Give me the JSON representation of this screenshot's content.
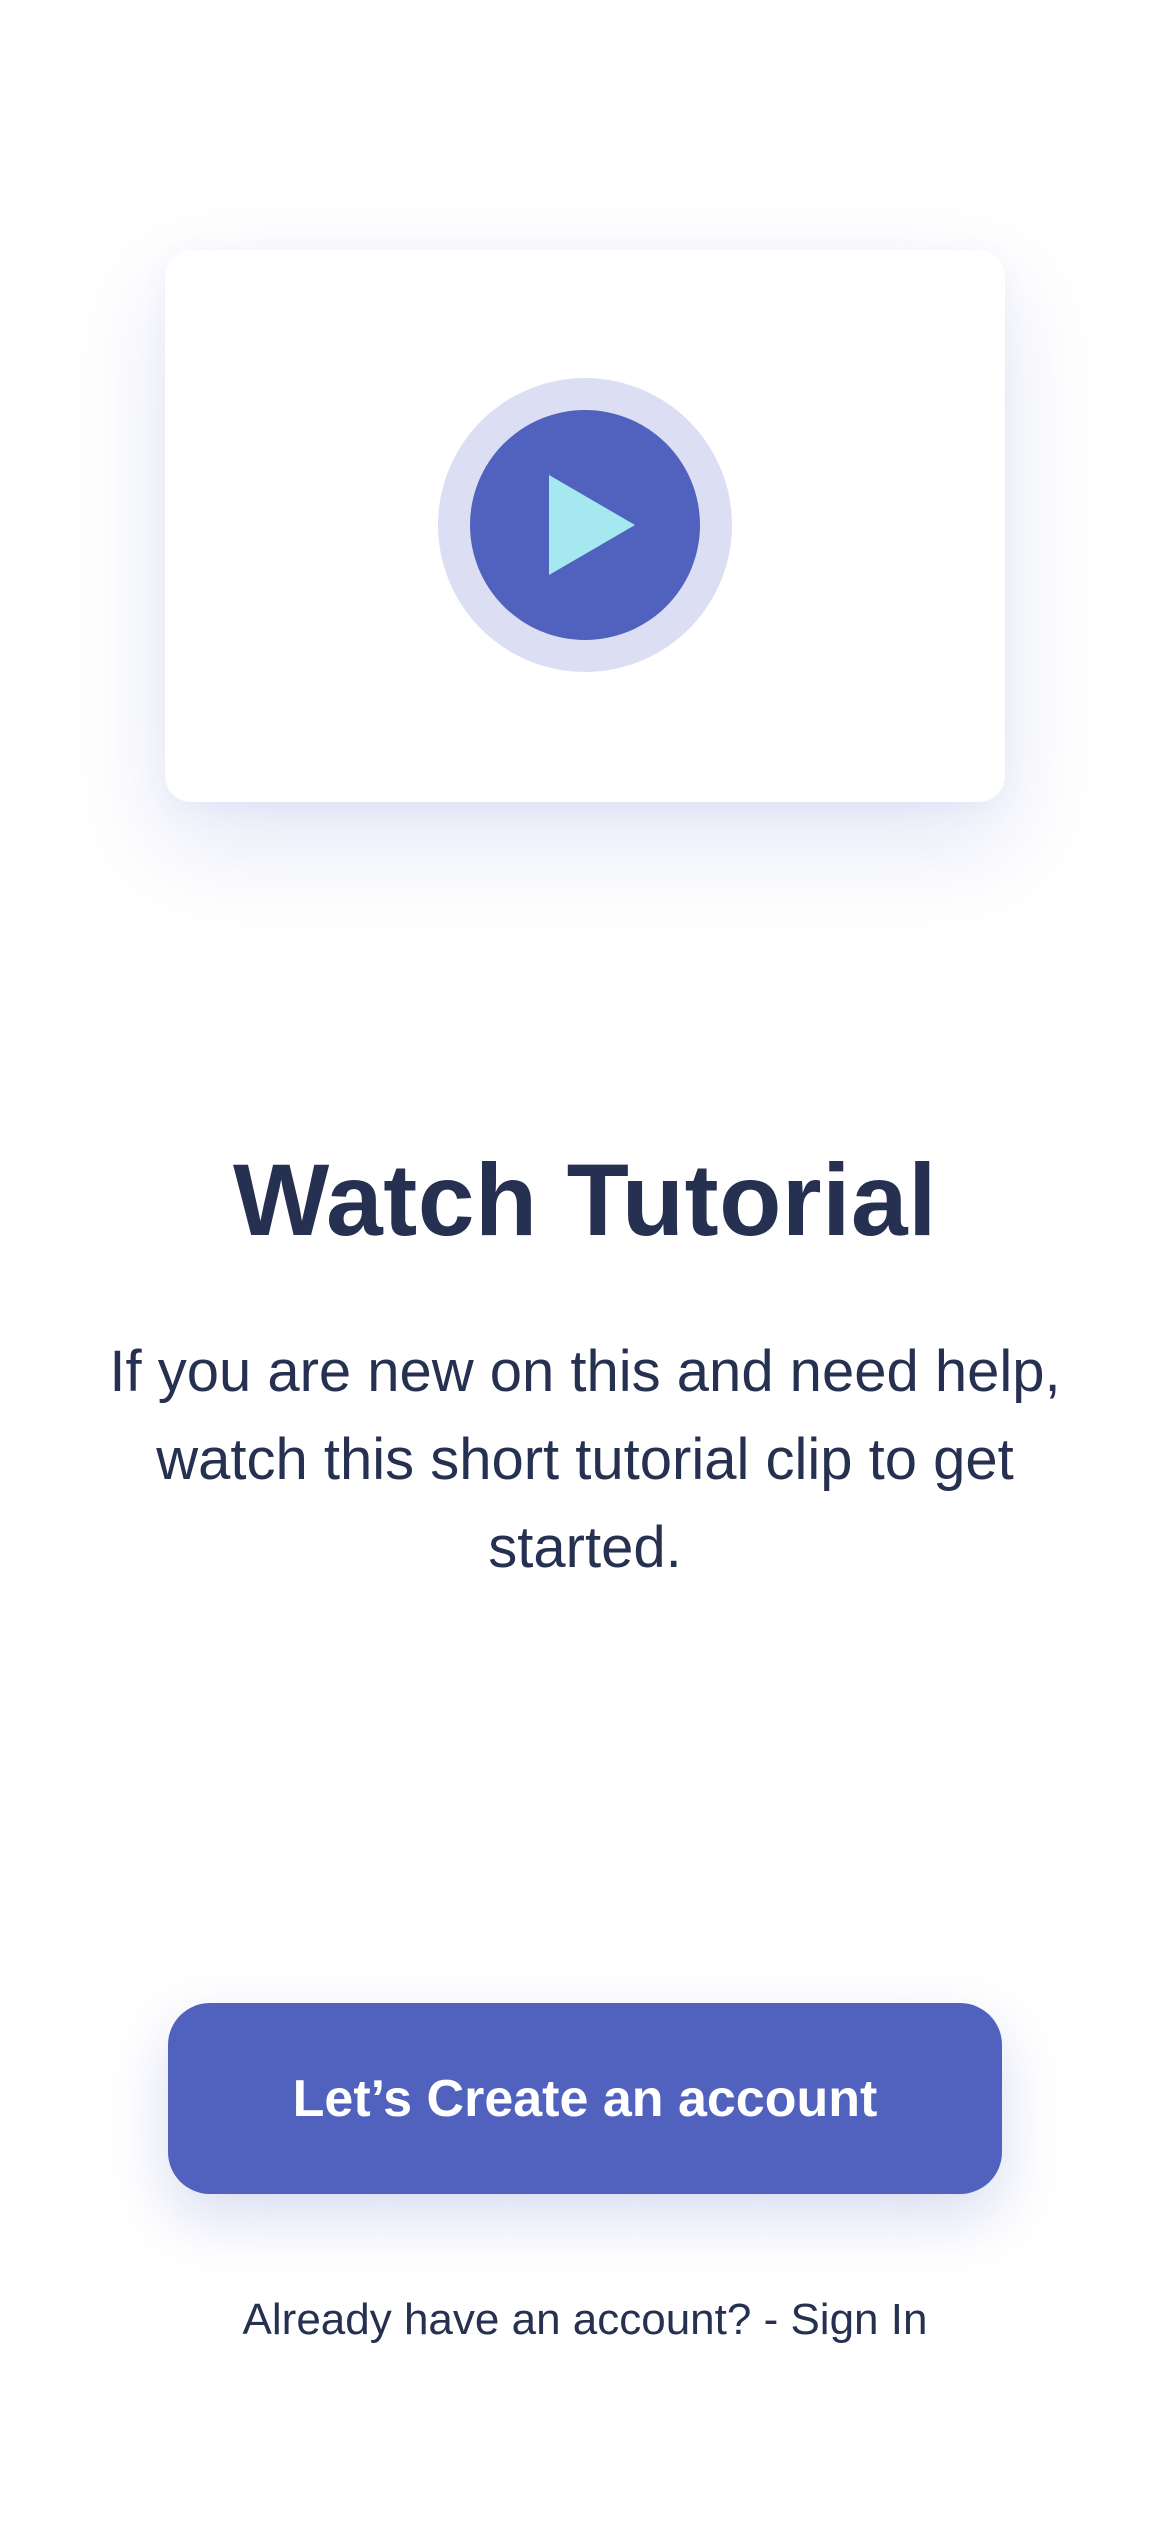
{
  "theme": {
    "primary": "#5062be",
    "play_ring": "#dcdff3",
    "play_triangle": "#a6e8f0",
    "text": "#263050",
    "background": "#ffffff"
  },
  "video": {
    "icon": "play-icon"
  },
  "content": {
    "title": "Watch Tutorial",
    "description": "If you are new on this and need help, watch this short tutorial clip to get started."
  },
  "cta": {
    "label": "Let’s Create an account"
  },
  "signin": {
    "prompt": "Already have an account? - ",
    "link": "Sign In"
  }
}
